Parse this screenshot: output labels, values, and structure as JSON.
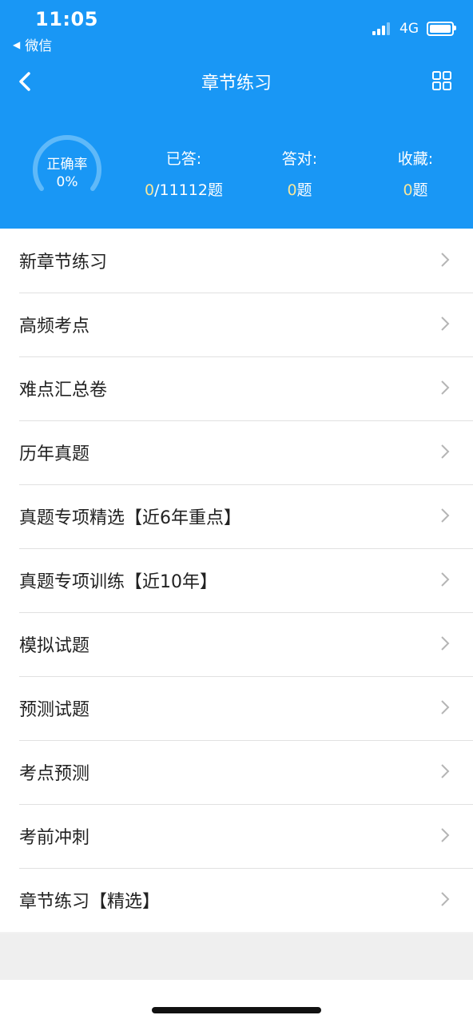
{
  "status_bar": {
    "time": "11:05",
    "back_app": "微信",
    "network": "4G"
  },
  "navbar": {
    "title": "章节练习"
  },
  "stats": {
    "accuracy_label": "正确率",
    "accuracy_value": "0%",
    "answered_label": "已答:",
    "answered_done": "0",
    "answered_total": "/11112题",
    "correct_label": "答对:",
    "correct_value": "0",
    "correct_unit": "题",
    "favorites_label": "收藏:",
    "favorites_value": "0",
    "favorites_unit": "题"
  },
  "list": {
    "items": [
      {
        "label": "新章节练习"
      },
      {
        "label": "高频考点"
      },
      {
        "label": "难点汇总卷"
      },
      {
        "label": "历年真题"
      },
      {
        "label": "真题专项精选【近6年重点】"
      },
      {
        "label": "真题专项训练【近10年】"
      },
      {
        "label": "模拟试题"
      },
      {
        "label": "预测试题"
      },
      {
        "label": "考点预测"
      },
      {
        "label": "考前冲刺"
      },
      {
        "label": "章节练习【精选】"
      }
    ]
  },
  "colors": {
    "primary": "#1997f5",
    "highlight": "#f5e69c",
    "divider": "#e1e1e1"
  }
}
